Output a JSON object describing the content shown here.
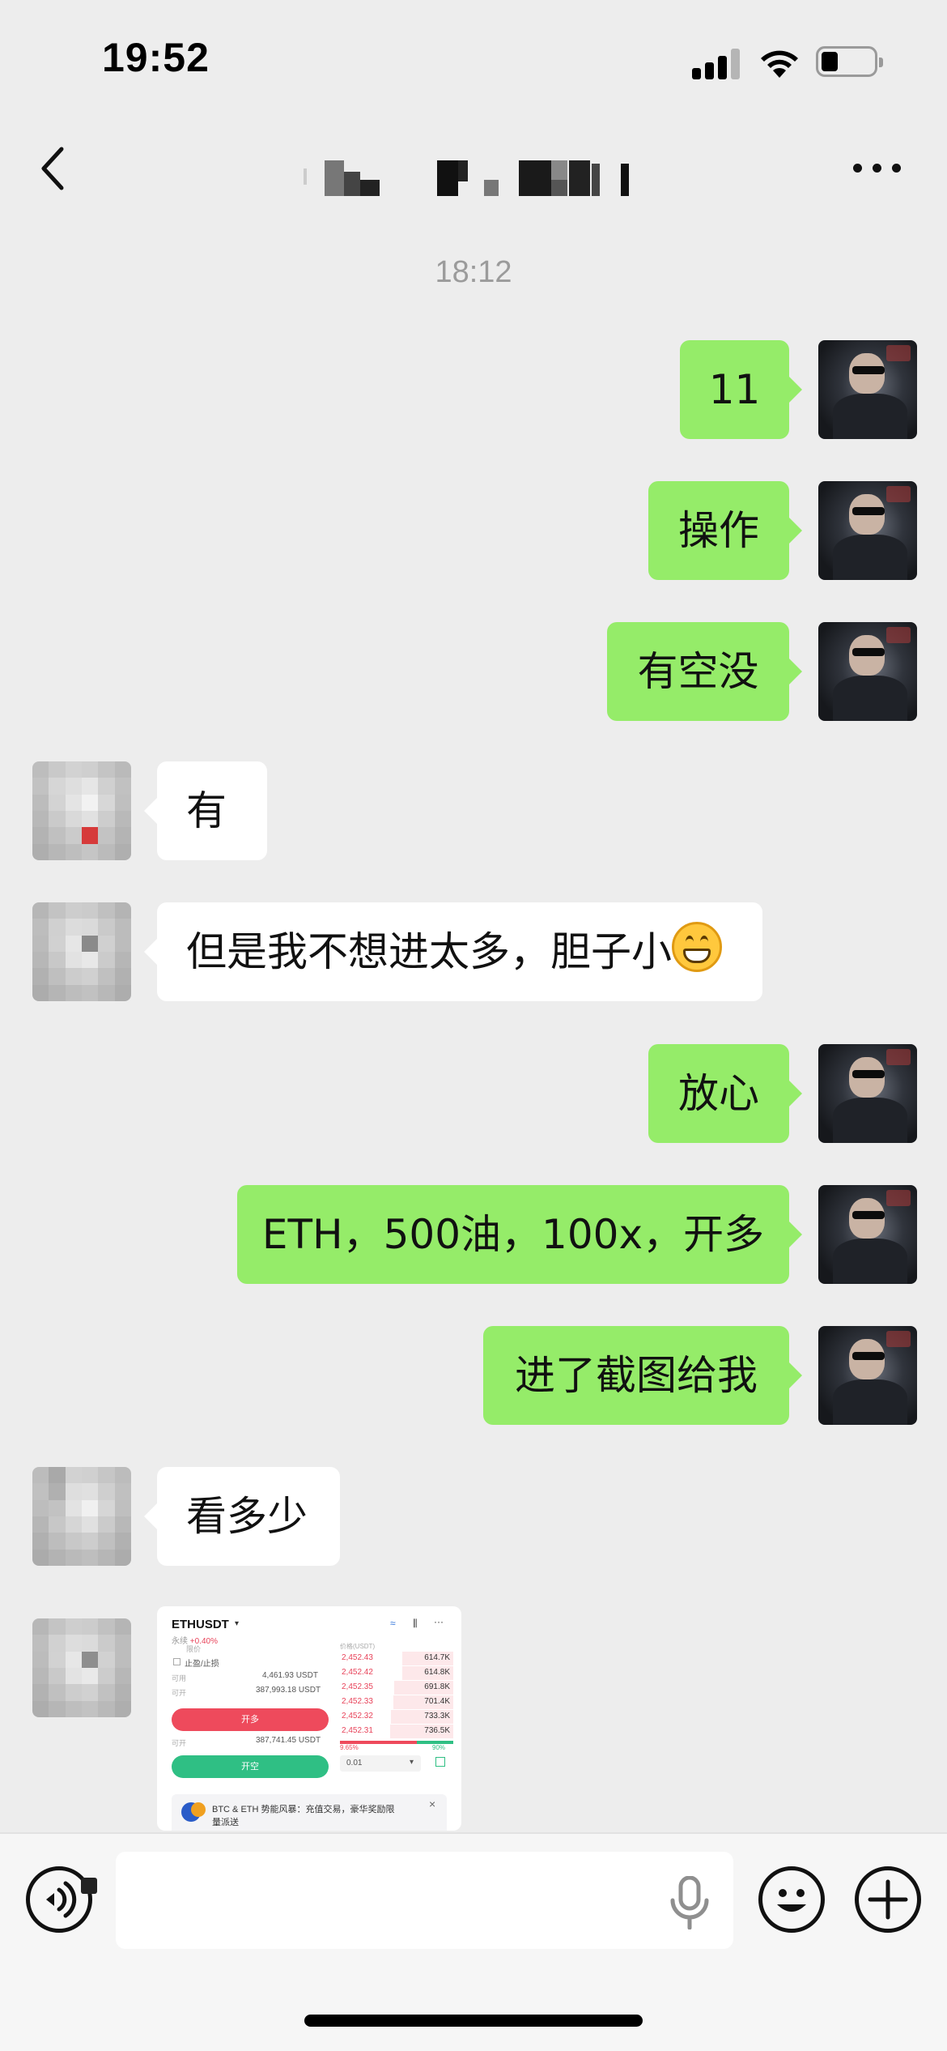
{
  "status_bar": {
    "time": "19:52"
  },
  "nav": {
    "title": ""
  },
  "chat": {
    "timestamp": "18:12",
    "messages": [
      {
        "side": "out",
        "text": "11"
      },
      {
        "side": "out",
        "text": "操作"
      },
      {
        "side": "out",
        "text": "有空没"
      },
      {
        "side": "in",
        "text": "有"
      },
      {
        "side": "in",
        "text": "但是我不想进太多，胆子小"
      },
      {
        "side": "out",
        "text": "放心"
      },
      {
        "side": "out",
        "text": "ETH，500油，100x，开多"
      },
      {
        "side": "out",
        "text": "进了截图给我"
      },
      {
        "side": "in",
        "text": "看多少"
      }
    ],
    "screenshot": {
      "pair": "ETHUSDT",
      "pair_type": "永续",
      "change": "+0.40%",
      "label_limit": "限价",
      "label_tpsl": "止盈/止损",
      "available_label": "可用",
      "available_value": "4,461.93 USDT",
      "open_label": "可开",
      "open_long_value": "387,993.18 USDT",
      "long_button": "开多",
      "open_short_value": "387,741.45 USDT",
      "short_button": "开空",
      "book_header": "价格(USDT)",
      "order_book": [
        {
          "price": "2,452.43",
          "qty": "614.7K",
          "depth": 0.45
        },
        {
          "price": "2,452.42",
          "qty": "614.8K",
          "depth": 0.45
        },
        {
          "price": "2,452.35",
          "qty": "691.8K",
          "depth": 0.52
        },
        {
          "price": "2,452.33",
          "qty": "701.4K",
          "depth": 0.53
        },
        {
          "price": "2,452.32",
          "qty": "733.3K",
          "depth": 0.55
        },
        {
          "price": "2,452.31",
          "qty": "736.5K",
          "depth": 0.56
        }
      ],
      "ratio_buy": "9.65%",
      "ratio_sell": "90%",
      "step_value": "0.01",
      "banner_text_1": "BTC & ETH 势能风暴：充值交易，豪华奖励限",
      "banner_text_2": "量派送",
      "banner_close": "×"
    }
  },
  "colors": {
    "background": "#ededed",
    "outgoing_bubble": "#95ec69",
    "incoming_bubble": "#ffffff",
    "timestamp": "#9b9b9b",
    "long_button": "#ee4a5c",
    "short_button": "#2fbf84"
  },
  "icons": {
    "back": "chevron-left-icon",
    "more": "more-dots-icon",
    "voice": "voice-icon",
    "mic": "microphone-icon",
    "emoji": "emoji-smile-icon",
    "plus": "plus-icon",
    "grin_emoji": "grin-emoji-icon"
  }
}
